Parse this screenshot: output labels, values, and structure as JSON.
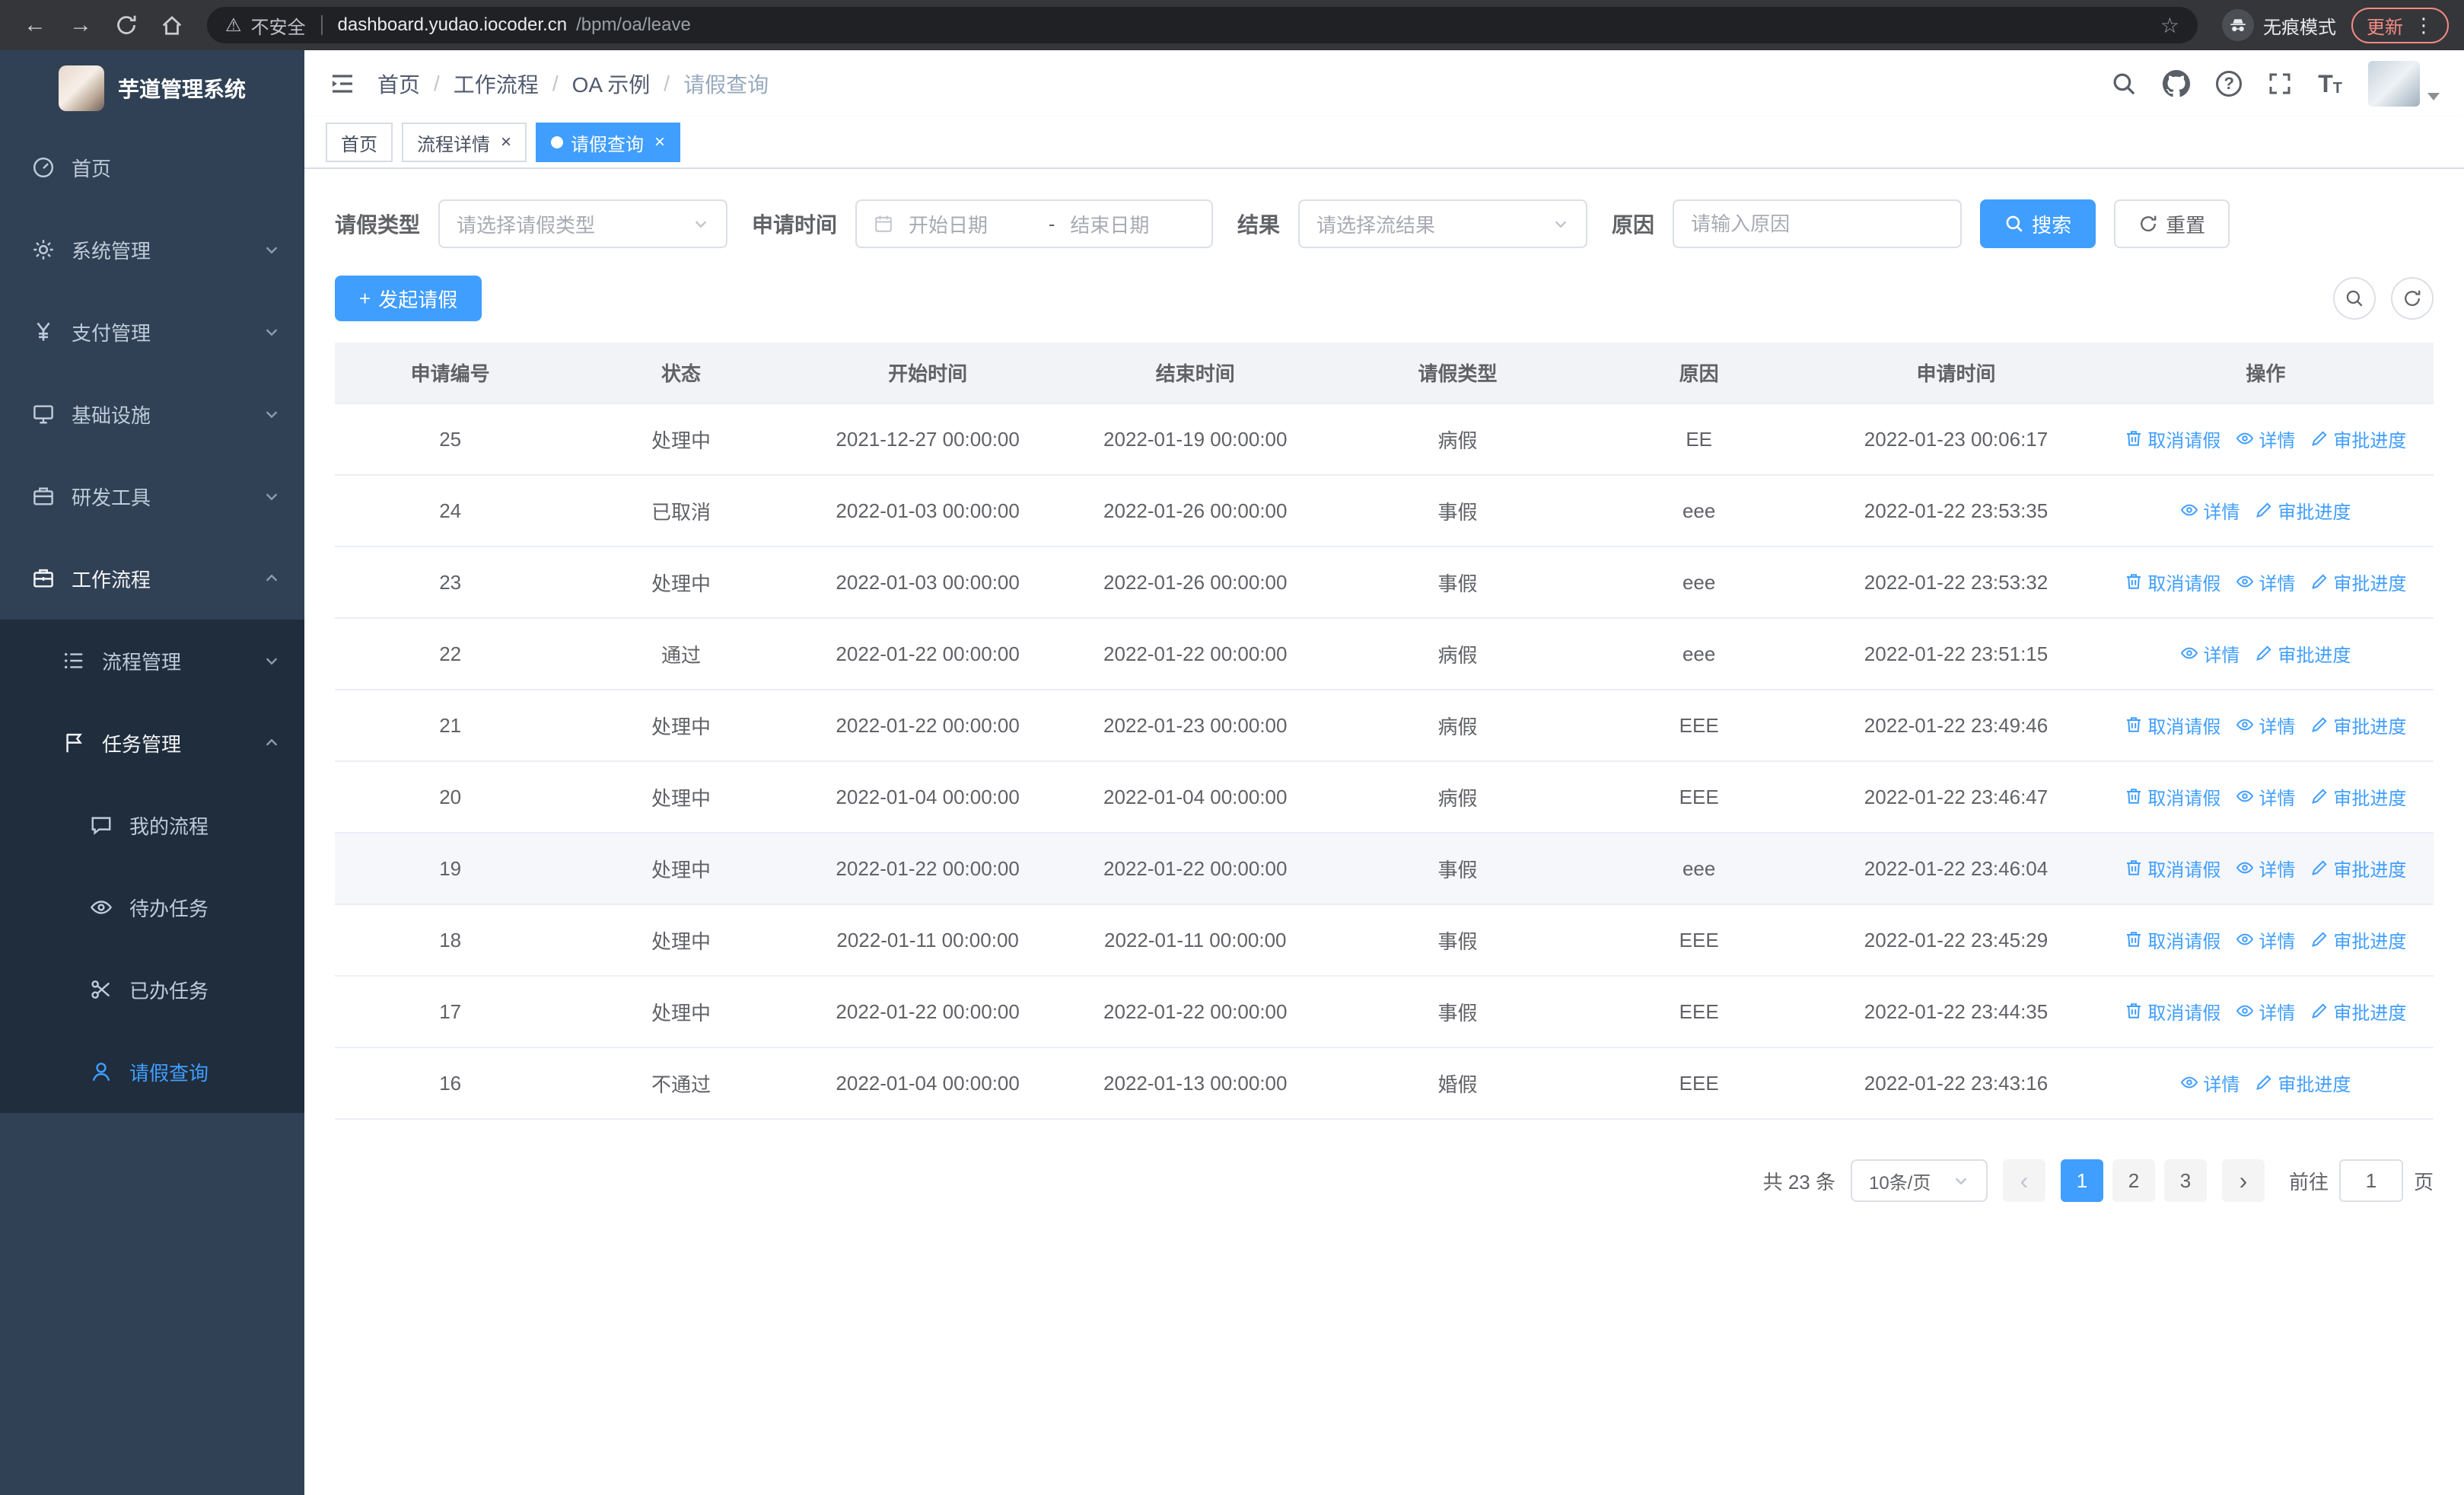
{
  "browser": {
    "security_warning": "不安全",
    "url_host": "dashboard.yudao.iocoder.cn",
    "url_path": "/bpm/oa/leave",
    "incognito_label": "无痕模式",
    "update_label": "更新"
  },
  "sidebar": {
    "logo_title": "芋道管理系统",
    "menu": [
      {
        "key": "home",
        "label": "首页",
        "icon": "dashboard-icon",
        "level": 1
      },
      {
        "key": "system",
        "label": "系统管理",
        "icon": "gear-icon",
        "level": 1,
        "chevron": "down"
      },
      {
        "key": "payment",
        "label": "支付管理",
        "icon": "yen-icon",
        "level": 1,
        "chevron": "down"
      },
      {
        "key": "infrastructure",
        "label": "基础设施",
        "icon": "infra-icon",
        "level": 1,
        "chevron": "down"
      },
      {
        "key": "dev-tools",
        "label": "研发工具",
        "icon": "tools-icon",
        "level": 1,
        "chevron": "down"
      },
      {
        "key": "workflow",
        "label": "工作流程",
        "icon": "workflow-icon",
        "level": 1,
        "chevron": "up",
        "trail": true
      },
      {
        "key": "process-management",
        "label": "流程管理",
        "icon": "process-icon",
        "level": 2,
        "chevron": "down"
      },
      {
        "key": "task-management",
        "label": "任务管理",
        "icon": "task-icon",
        "level": 2,
        "chevron": "up",
        "trail": true
      },
      {
        "key": "my-process",
        "label": "我的流程",
        "icon": "chat-icon",
        "level": 3
      },
      {
        "key": "todo-tasks",
        "label": "待办任务",
        "icon": "eye-icon",
        "level": 3
      },
      {
        "key": "done-tasks",
        "label": "已办任务",
        "icon": "scissors-icon",
        "level": 3
      },
      {
        "key": "leave-query",
        "label": "请假查询",
        "icon": "user-icon",
        "level": 3,
        "active": true
      }
    ]
  },
  "header": {
    "breadcrumb": [
      "首页",
      "工作流程",
      "OA 示例",
      "请假查询"
    ],
    "breadcrumb_separator": "/"
  },
  "tabs": [
    {
      "key": "home",
      "label": "首页",
      "closable": false,
      "active": false
    },
    {
      "key": "process-detail",
      "label": "流程详情",
      "closable": true,
      "active": false
    },
    {
      "key": "leave-query",
      "label": "请假查询",
      "closable": true,
      "active": true
    }
  ],
  "filters": {
    "leave_type_label": "请假类型",
    "leave_type_placeholder": "请选择请假类型",
    "apply_time_label": "申请时间",
    "start_date_placeholder": "开始日期",
    "date_separator": "-",
    "end_date_placeholder": "结束日期",
    "result_label": "结果",
    "result_placeholder": "请选择流结果",
    "reason_label": "原因",
    "reason_placeholder": "请输入原因",
    "search_label": "搜索",
    "reset_label": "重置"
  },
  "toolbar": {
    "create_label": "发起请假"
  },
  "table": {
    "columns": [
      "申请编号",
      "状态",
      "开始时间",
      "结束时间",
      "请假类型",
      "原因",
      "申请时间",
      "操作"
    ],
    "action_labels": {
      "cancel": "取消请假",
      "detail": "详情",
      "progress": "审批进度"
    },
    "rows": [
      {
        "id": "25",
        "status": "处理中",
        "start": "2021-12-27 00:00:00",
        "end": "2022-01-19 00:00:00",
        "type": "病假",
        "reason": "EE",
        "applied": "2022-01-23 00:06:17",
        "actions": [
          "cancel",
          "detail",
          "progress"
        ]
      },
      {
        "id": "24",
        "status": "已取消",
        "start": "2022-01-03 00:00:00",
        "end": "2022-01-26 00:00:00",
        "type": "事假",
        "reason": "eee",
        "applied": "2022-01-22 23:53:35",
        "actions": [
          "detail",
          "progress"
        ]
      },
      {
        "id": "23",
        "status": "处理中",
        "start": "2022-01-03 00:00:00",
        "end": "2022-01-26 00:00:00",
        "type": "事假",
        "reason": "eee",
        "applied": "2022-01-22 23:53:32",
        "actions": [
          "cancel",
          "detail",
          "progress"
        ]
      },
      {
        "id": "22",
        "status": "通过",
        "start": "2022-01-22 00:00:00",
        "end": "2022-01-22 00:00:00",
        "type": "病假",
        "reason": "eee",
        "applied": "2022-01-22 23:51:15",
        "actions": [
          "detail",
          "progress"
        ]
      },
      {
        "id": "21",
        "status": "处理中",
        "start": "2022-01-22 00:00:00",
        "end": "2022-01-23 00:00:00",
        "type": "病假",
        "reason": "EEE",
        "applied": "2022-01-22 23:49:46",
        "actions": [
          "cancel",
          "detail",
          "progress"
        ]
      },
      {
        "id": "20",
        "status": "处理中",
        "start": "2022-01-04 00:00:00",
        "end": "2022-01-04 00:00:00",
        "type": "病假",
        "reason": "EEE",
        "applied": "2022-01-22 23:46:47",
        "actions": [
          "cancel",
          "detail",
          "progress"
        ]
      },
      {
        "id": "19",
        "status": "处理中",
        "start": "2022-01-22 00:00:00",
        "end": "2022-01-22 00:00:00",
        "type": "事假",
        "reason": "eee",
        "applied": "2022-01-22 23:46:04",
        "actions": [
          "cancel",
          "detail",
          "progress"
        ],
        "hovered": true
      },
      {
        "id": "18",
        "status": "处理中",
        "start": "2022-01-11 00:00:00",
        "end": "2022-01-11 00:00:00",
        "type": "事假",
        "reason": "EEE",
        "applied": "2022-01-22 23:45:29",
        "actions": [
          "cancel",
          "detail",
          "progress"
        ]
      },
      {
        "id": "17",
        "status": "处理中",
        "start": "2022-01-22 00:00:00",
        "end": "2022-01-22 00:00:00",
        "type": "事假",
        "reason": "EEE",
        "applied": "2022-01-22 23:44:35",
        "actions": [
          "cancel",
          "detail",
          "progress"
        ]
      },
      {
        "id": "16",
        "status": "不通过",
        "start": "2022-01-04 00:00:00",
        "end": "2022-01-13 00:00:00",
        "type": "婚假",
        "reason": "EEE",
        "applied": "2022-01-22 23:43:16",
        "actions": [
          "detail",
          "progress"
        ]
      }
    ]
  },
  "pagination": {
    "total_text": "共 23 条",
    "page_size": "10条/页",
    "pages": [
      "1",
      "2",
      "3"
    ],
    "active_page": "1",
    "jump_prefix": "前往",
    "jump_value": "1",
    "jump_suffix": "页"
  },
  "colors": {
    "accent": "#409eff",
    "sidebar_bg": "#304156",
    "submenu_bg": "#1f2d3d",
    "chrome_bg": "#35363a",
    "urlbar_bg": "#202124",
    "update_color": "#f28b82"
  }
}
